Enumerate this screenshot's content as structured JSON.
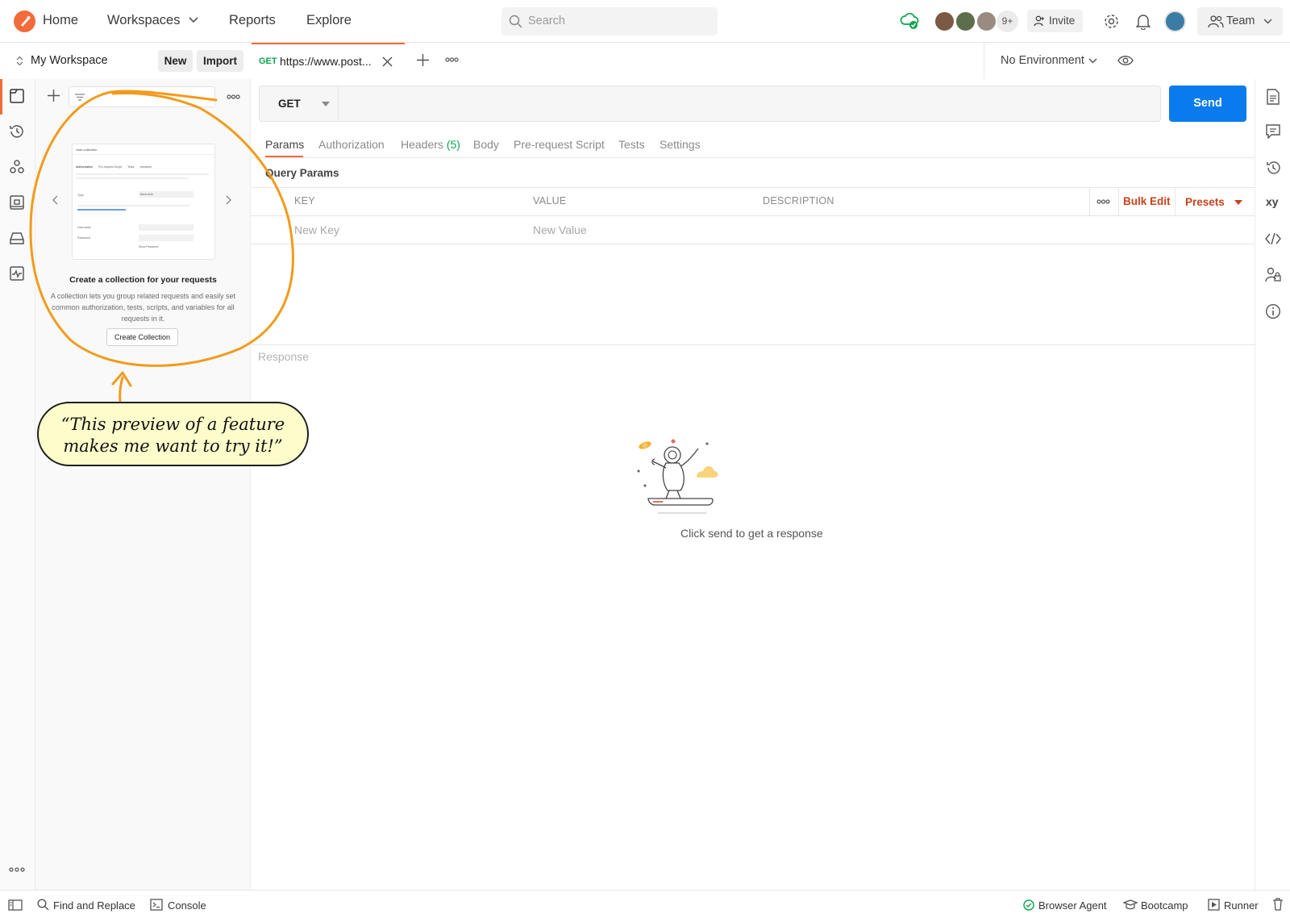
{
  "colors": {
    "accent": "#f26b3a",
    "send": "#097bed",
    "method_get": "#0ba44b",
    "orange_link": "#c8411a",
    "annotation_stroke": "#f29b1b",
    "bubble_fill": "#fdfccb"
  },
  "header": {
    "nav": [
      "Home",
      "Workspaces",
      "Reports",
      "Explore"
    ],
    "search_placeholder": "Search",
    "collaborators_overflow": "9+",
    "invite_label": "Invite",
    "team_label": "Team",
    "icons": [
      "postman-logo-icon",
      "sync-cloud-icon",
      "settings-gear-icon",
      "bell-icon",
      "user-avatar"
    ]
  },
  "workspace": {
    "title": "My Workspace",
    "new_label": "New",
    "import_label": "Import"
  },
  "tab": {
    "method": "GET",
    "url": "https://www.post...",
    "environment": "No Environment"
  },
  "sidebar": {
    "empty_title": "Create a collection for your requests",
    "empty_desc": "A collection lets you group related requests and easily set common authorization, tests, scripts, and variables for all requests in it.",
    "create_label": "Create Collection",
    "preview_mini": {
      "title": "User collection",
      "tabs": [
        "Authorization",
        "Pre-request Script",
        "Tests",
        "Variables"
      ],
      "type_label": "Type",
      "type_value": "Basic Auth",
      "username_label": "Username",
      "password_label": "Password",
      "show_password": "Show Password"
    }
  },
  "request": {
    "method": "GET",
    "send_label": "Send",
    "tabs": [
      "Params",
      "Authorization",
      "Headers",
      "Body",
      "Pre-request Script",
      "Tests",
      "Settings"
    ],
    "headers_count": "(5)",
    "query_params_label": "Query Params",
    "columns": [
      "KEY",
      "VALUE",
      "DESCRIPTION"
    ],
    "key_placeholder": "New Key",
    "value_placeholder": "New Value",
    "bulk_edit_label": "Bulk Edit",
    "presets_label": "Presets"
  },
  "response": {
    "label": "Response",
    "empty_text": "Click send to get a response"
  },
  "statusbar": {
    "left": [
      "Find and Replace",
      "Console"
    ],
    "right": [
      "Browser Agent",
      "Bootcamp",
      "Runner"
    ]
  },
  "annotation": {
    "line1": "“This preview of a feature",
    "line2": "makes me want to try it!”"
  }
}
